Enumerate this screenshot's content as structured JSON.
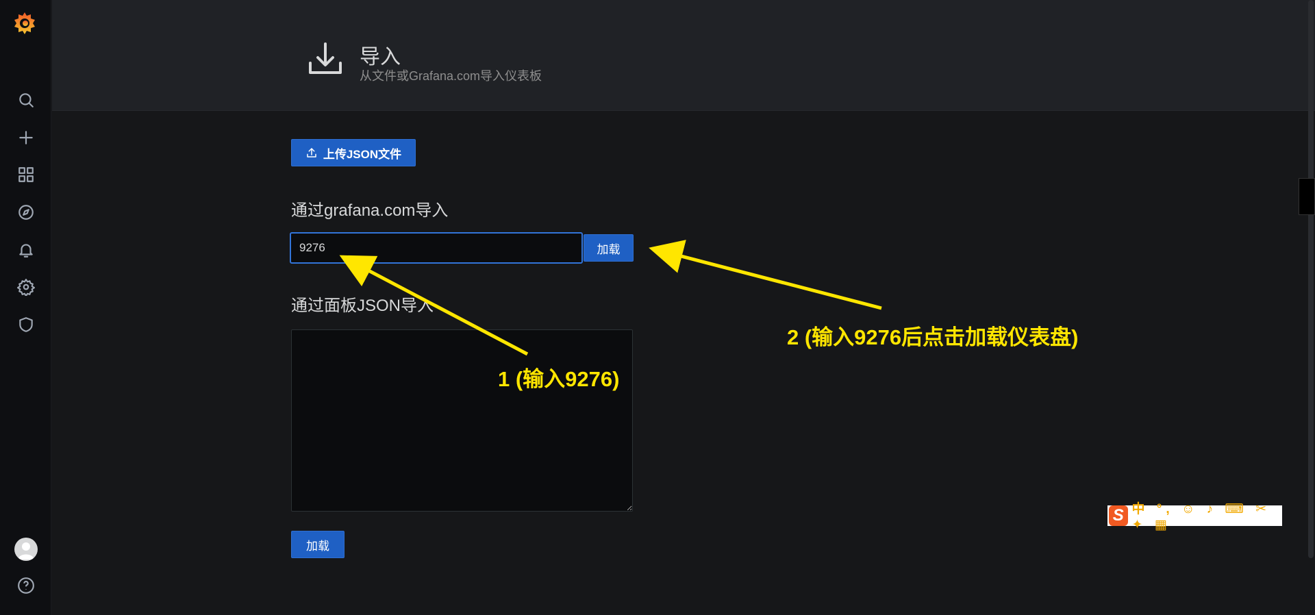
{
  "header": {
    "title": "导入",
    "subtitle": "从文件或Grafana.com导入仪表板"
  },
  "sidebar": {
    "items": [
      {
        "icon": "search-icon"
      },
      {
        "icon": "plus-icon"
      },
      {
        "icon": "dashboards-icon"
      },
      {
        "icon": "explore-icon"
      },
      {
        "icon": "bell-icon"
      },
      {
        "icon": "gear-icon"
      },
      {
        "icon": "shield-icon"
      }
    ]
  },
  "main": {
    "upload_label": "上传JSON文件",
    "grafana_section_label": "通过grafana.com导入",
    "grafana_input_value": "9276",
    "grafana_load_label": "加载",
    "json_section_label": "通过面板JSON导入",
    "json_load_label": "加载"
  },
  "annotations": {
    "step1": "1 (输入9276)",
    "step2": "2 (输入9276后点击加载仪表盘)"
  },
  "ime": {
    "logo": "S",
    "text": "中 °, ☺ ♪ ⌨ ✂ ✦ ▦"
  },
  "colors": {
    "accent": "#1f60c4",
    "annotation": "#ffe600",
    "background": "#161719"
  }
}
